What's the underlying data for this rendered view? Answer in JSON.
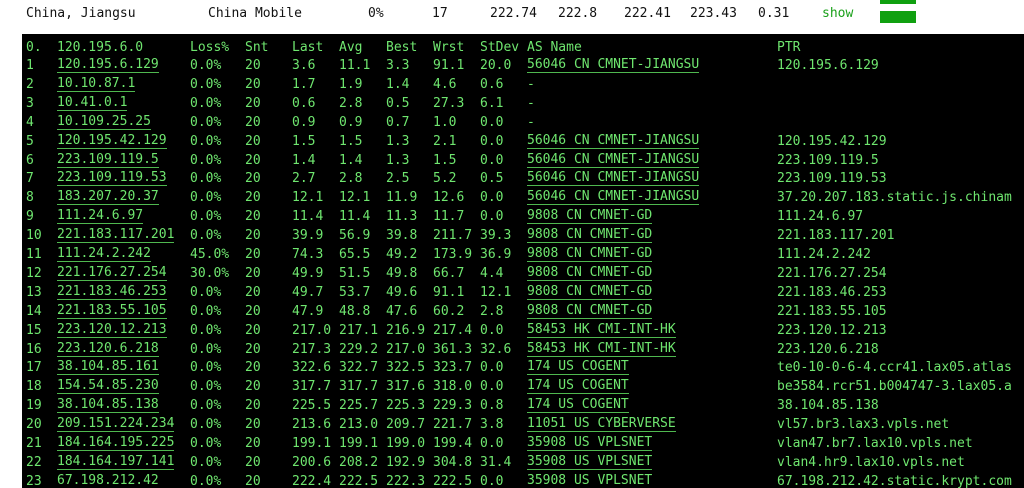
{
  "summary": {
    "location": "China, Jiangsu",
    "isp": "China Mobile",
    "loss": "0%",
    "snt": "17",
    "last": "222.74",
    "avg": "222.8",
    "best": "222.41",
    "wrst": "223.43",
    "stdev": "0.31",
    "show_label": "show",
    "bar_color": "#10a010"
  },
  "table": {
    "headers": {
      "hop": "0.",
      "host": "120.195.6.0",
      "loss": "Loss%",
      "snt": "Snt",
      "last": "Last",
      "avg": "Avg",
      "best": "Best",
      "wrst": "Wrst",
      "stdev": "StDev",
      "as": "AS Name",
      "ptr": "PTR"
    },
    "rows": [
      {
        "hop": "1",
        "host": "120.195.6.129",
        "loss": "0.0%",
        "snt": "20",
        "last": "3.6",
        "avg": "11.1",
        "best": "3.3",
        "wrst": "91.1",
        "stdev": "20.0",
        "as": "56046 CN CMNET-JIANGSU",
        "ptr": "120.195.6.129"
      },
      {
        "hop": "2",
        "host": "10.10.87.1",
        "loss": "0.0%",
        "snt": "20",
        "last": "1.7",
        "avg": "1.9",
        "best": "1.4",
        "wrst": "4.6",
        "stdev": "0.6",
        "as": "-",
        "ptr": ""
      },
      {
        "hop": "3",
        "host": "10.41.0.1",
        "loss": "0.0%",
        "snt": "20",
        "last": "0.6",
        "avg": "2.8",
        "best": "0.5",
        "wrst": "27.3",
        "stdev": "6.1",
        "as": "-",
        "ptr": ""
      },
      {
        "hop": "4",
        "host": "10.109.25.25",
        "loss": "0.0%",
        "snt": "20",
        "last": "0.9",
        "avg": "0.9",
        "best": "0.7",
        "wrst": "1.0",
        "stdev": "0.0",
        "as": "-",
        "ptr": ""
      },
      {
        "hop": "5",
        "host": "120.195.42.129",
        "loss": "0.0%",
        "snt": "20",
        "last": "1.5",
        "avg": "1.5",
        "best": "1.3",
        "wrst": "2.1",
        "stdev": "0.0",
        "as": "56046 CN CMNET-JIANGSU",
        "ptr": "120.195.42.129"
      },
      {
        "hop": "6",
        "host": "223.109.119.5",
        "loss": "0.0%",
        "snt": "20",
        "last": "1.4",
        "avg": "1.4",
        "best": "1.3",
        "wrst": "1.5",
        "stdev": "0.0",
        "as": "56046 CN CMNET-JIANGSU",
        "ptr": "223.109.119.5"
      },
      {
        "hop": "7",
        "host": "223.109.119.53",
        "loss": "0.0%",
        "snt": "20",
        "last": "2.7",
        "avg": "2.8",
        "best": "2.5",
        "wrst": "5.2",
        "stdev": "0.5",
        "as": "56046 CN CMNET-JIANGSU",
        "ptr": "223.109.119.53"
      },
      {
        "hop": "8",
        "host": "183.207.20.37",
        "loss": "0.0%",
        "snt": "20",
        "last": "12.1",
        "avg": "12.1",
        "best": "11.9",
        "wrst": "12.6",
        "stdev": "0.0",
        "as": "56046 CN CMNET-JIANGSU",
        "ptr": "37.20.207.183.static.js.chinam"
      },
      {
        "hop": "9",
        "host": "111.24.6.97",
        "loss": "0.0%",
        "snt": "20",
        "last": "11.4",
        "avg": "11.4",
        "best": "11.3",
        "wrst": "11.7",
        "stdev": "0.0",
        "as": "9808 CN CMNET-GD",
        "ptr": "111.24.6.97"
      },
      {
        "hop": "10",
        "host": "221.183.117.201",
        "loss": "0.0%",
        "snt": "20",
        "last": "39.9",
        "avg": "56.9",
        "best": "39.8",
        "wrst": "211.7",
        "stdev": "39.3",
        "as": "9808 CN CMNET-GD",
        "ptr": "221.183.117.201"
      },
      {
        "hop": "11",
        "host": "111.24.2.242",
        "loss": "45.0%",
        "snt": "20",
        "last": "74.3",
        "avg": "65.5",
        "best": "49.2",
        "wrst": "173.9",
        "stdev": "36.9",
        "as": "9808 CN CMNET-GD",
        "ptr": "111.24.2.242"
      },
      {
        "hop": "12",
        "host": "221.176.27.254",
        "loss": "30.0%",
        "snt": "20",
        "last": "49.9",
        "avg": "51.5",
        "best": "49.8",
        "wrst": "66.7",
        "stdev": "4.4",
        "as": "9808 CN CMNET-GD",
        "ptr": "221.176.27.254"
      },
      {
        "hop": "13",
        "host": "221.183.46.253",
        "loss": "0.0%",
        "snt": "20",
        "last": "49.7",
        "avg": "53.7",
        "best": "49.6",
        "wrst": "91.1",
        "stdev": "12.1",
        "as": "9808 CN CMNET-GD",
        "ptr": "221.183.46.253"
      },
      {
        "hop": "14",
        "host": "221.183.55.105",
        "loss": "0.0%",
        "snt": "20",
        "last": "47.9",
        "avg": "48.8",
        "best": "47.6",
        "wrst": "60.2",
        "stdev": "2.8",
        "as": "9808 CN CMNET-GD",
        "ptr": "221.183.55.105"
      },
      {
        "hop": "15",
        "host": "223.120.12.213",
        "loss": "0.0%",
        "snt": "20",
        "last": "217.0",
        "avg": "217.1",
        "best": "216.9",
        "wrst": "217.4",
        "stdev": "0.0",
        "as": "58453 HK CMI-INT-HK",
        "ptr": "223.120.12.213"
      },
      {
        "hop": "16",
        "host": "223.120.6.218",
        "loss": "0.0%",
        "snt": "20",
        "last": "217.3",
        "avg": "229.2",
        "best": "217.0",
        "wrst": "361.3",
        "stdev": "32.6",
        "as": "58453 HK CMI-INT-HK",
        "ptr": "223.120.6.218"
      },
      {
        "hop": "17",
        "host": "38.104.85.161",
        "loss": "0.0%",
        "snt": "20",
        "last": "322.6",
        "avg": "322.7",
        "best": "322.5",
        "wrst": "323.7",
        "stdev": "0.0",
        "as": "174 US COGENT",
        "ptr": "te0-10-0-6-4.ccr41.lax05.atlas"
      },
      {
        "hop": "18",
        "host": "154.54.85.230",
        "loss": "0.0%",
        "snt": "20",
        "last": "317.7",
        "avg": "317.7",
        "best": "317.6",
        "wrst": "318.0",
        "stdev": "0.0",
        "as": "174 US COGENT",
        "ptr": "be3584.rcr51.b004747-3.lax05.a"
      },
      {
        "hop": "19",
        "host": "38.104.85.138",
        "loss": "0.0%",
        "snt": "20",
        "last": "225.5",
        "avg": "225.7",
        "best": "225.3",
        "wrst": "229.3",
        "stdev": "0.8",
        "as": "174 US COGENT",
        "ptr": "38.104.85.138"
      },
      {
        "hop": "20",
        "host": "209.151.224.234",
        "loss": "0.0%",
        "snt": "20",
        "last": "213.6",
        "avg": "213.0",
        "best": "209.7",
        "wrst": "221.7",
        "stdev": "3.8",
        "as": "11051 US CYBERVERSE",
        "ptr": "vl57.br3.lax3.vpls.net"
      },
      {
        "hop": "21",
        "host": "184.164.195.225",
        "loss": "0.0%",
        "snt": "20",
        "last": "199.1",
        "avg": "199.1",
        "best": "199.0",
        "wrst": "199.4",
        "stdev": "0.0",
        "as": "35908 US VPLSNET",
        "ptr": "vlan47.br7.lax10.vpls.net"
      },
      {
        "hop": "22",
        "host": "184.164.197.141",
        "loss": "0.0%",
        "snt": "20",
        "last": "200.6",
        "avg": "208.2",
        "best": "192.9",
        "wrst": "304.8",
        "stdev": "31.4",
        "as": "35908 US VPLSNET",
        "ptr": "vlan4.hr9.lax10.vpls.net"
      },
      {
        "hop": "23",
        "host": "67.198.212.42",
        "loss": "0.0%",
        "snt": "20",
        "last": "222.4",
        "avg": "222.5",
        "best": "222.3",
        "wrst": "222.5",
        "stdev": "0.0",
        "as": "35908 US VPLSNET",
        "ptr": "67.198.212.42.static.krypt.com"
      }
    ]
  },
  "colors": {
    "terminal_bg": "#000000",
    "terminal_text": "#6fe66f",
    "summary_text": "#111111",
    "show_link": "#1aa01a"
  }
}
